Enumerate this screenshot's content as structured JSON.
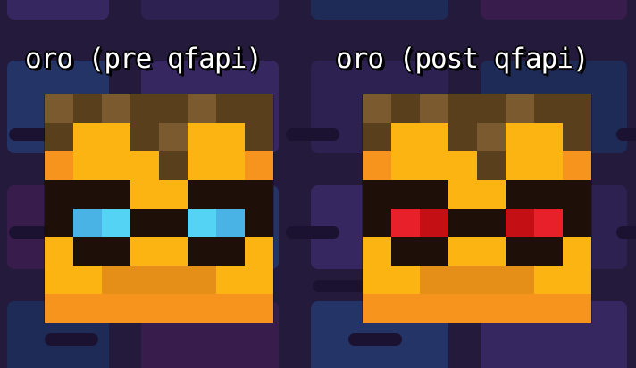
{
  "heads": [
    {
      "id": "pre",
      "caption": "oro (pre qfapi)",
      "pixels": [
        [
          "H1",
          "H2",
          "H1",
          "H2",
          "H2",
          "H1",
          "H2",
          "H2"
        ],
        [
          "H2",
          "Y",
          "Y",
          "H2",
          "H1",
          "Y",
          "Y",
          "H2"
        ],
        [
          "O",
          "Y",
          "Y",
          "Y",
          "H2",
          "Y",
          "Y",
          "O"
        ],
        [
          "D",
          "D",
          "D",
          "Y",
          "Y",
          "D",
          "D",
          "D"
        ],
        [
          "D",
          "E1",
          "E2",
          "D",
          "D",
          "E2",
          "E1",
          "D"
        ],
        [
          "Y",
          "D",
          "D",
          "Y",
          "Y",
          "D",
          "D",
          "Y"
        ],
        [
          "Y",
          "Y",
          "M",
          "M",
          "M",
          "M",
          "Y",
          "Y"
        ],
        [
          "O",
          "O",
          "O",
          "O",
          "O",
          "O",
          "O",
          "O"
        ]
      ]
    },
    {
      "id": "post",
      "caption": "oro (post qfapi)",
      "pixels": [
        [
          "H1",
          "H2",
          "H1",
          "H2",
          "H2",
          "H1",
          "H2",
          "H2"
        ],
        [
          "H2",
          "Y",
          "Y",
          "H2",
          "H1",
          "Y",
          "Y",
          "H2"
        ],
        [
          "O",
          "Y",
          "Y",
          "Y",
          "H2",
          "Y",
          "Y",
          "O"
        ],
        [
          "D",
          "D",
          "D",
          "Y",
          "Y",
          "D",
          "D",
          "D"
        ],
        [
          "D",
          "R1",
          "R2",
          "D",
          "D",
          "R2",
          "R1",
          "D"
        ],
        [
          "Y",
          "D",
          "D",
          "Y",
          "Y",
          "D",
          "D",
          "Y"
        ],
        [
          "Y",
          "Y",
          "M",
          "M",
          "M",
          "M",
          "Y",
          "Y"
        ],
        [
          "O",
          "O",
          "O",
          "O",
          "O",
          "O",
          "O",
          "O"
        ]
      ]
    }
  ],
  "palette": {
    "H1": "#7a5a2e",
    "H2": "#5a3f1c",
    "Y": "#fbb412",
    "O": "#f7941d",
    "M": "#e58f19",
    "D": "#1e1008",
    "E1": "#4ab3e6",
    "E2": "#55d3f4",
    "R1": "#e8202a",
    "R2": "#c40f14"
  },
  "background": {
    "base": "#241a3c",
    "tile_colors": [
      "#3a2a66",
      "#2f2356",
      "#1d2f5c",
      "#3b1d4f",
      "#26396e"
    ],
    "line_color": "#1a1230"
  }
}
